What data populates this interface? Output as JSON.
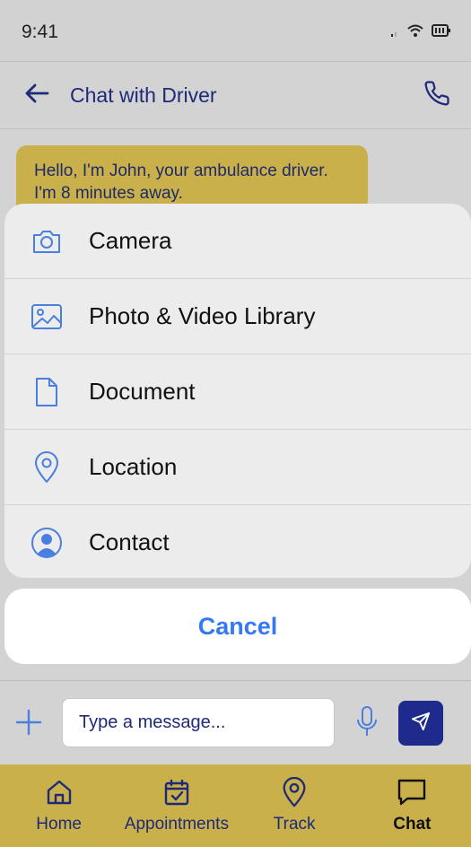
{
  "status_bar": {
    "time": "9:41"
  },
  "header": {
    "title": "Chat with Driver"
  },
  "messages": [
    {
      "text": "Hello, I'm John, your ambulance driver. I'm 8 minutes away."
    }
  ],
  "action_sheet": {
    "items": [
      {
        "label": "Camera",
        "icon": "camera-icon"
      },
      {
        "label": "Photo & Video Library",
        "icon": "image-icon"
      },
      {
        "label": "Document",
        "icon": "document-icon"
      },
      {
        "label": "Location",
        "icon": "location-pin-icon"
      },
      {
        "label": "Contact",
        "icon": "contact-icon"
      }
    ],
    "cancel_label": "Cancel"
  },
  "input_bar": {
    "placeholder": "Type a message..."
  },
  "bottom_nav": {
    "items": [
      {
        "label": "Home",
        "icon": "home-icon"
      },
      {
        "label": "Appointments",
        "icon": "calendar-icon"
      },
      {
        "label": "Track",
        "icon": "location-pin-icon"
      },
      {
        "label": "Chat",
        "icon": "chat-icon",
        "active": true
      }
    ]
  },
  "colors": {
    "accent_yellow": "#c9b04a",
    "navy": "#1e2a78",
    "icon_blue": "#4a7fe0",
    "cancel_blue": "#3478f6"
  }
}
